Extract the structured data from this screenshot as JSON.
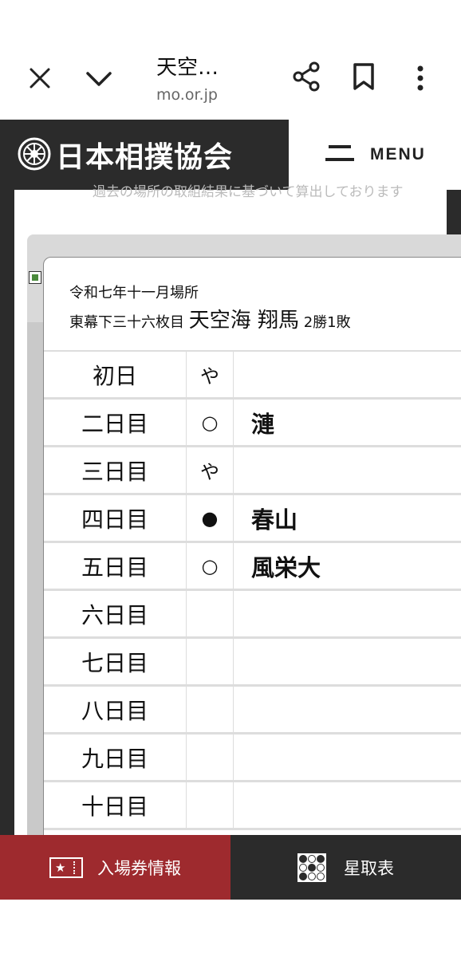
{
  "browser": {
    "page_title": "天空…",
    "url": "mo.or.jp",
    "icons": [
      "close-icon",
      "chevron-down-icon",
      "share-icon",
      "bookmark-icon",
      "more-vert-icon"
    ]
  },
  "site": {
    "logo_text": "日本相撲協会",
    "menu_label": "MENU",
    "behind_text": "過去の場所の取組結果に基づいて算出しております"
  },
  "card": {
    "basho": "令和七年十一月場所",
    "rank": "東幕下三十六枚目",
    "name": "天空海 翔馬",
    "record": "2勝1敗",
    "rows": [
      {
        "day": "初日",
        "result": "や",
        "opponent": ""
      },
      {
        "day": "二日目",
        "result": "○",
        "opponent": "漣"
      },
      {
        "day": "三日目",
        "result": "や",
        "opponent": ""
      },
      {
        "day": "四日目",
        "result": "●",
        "opponent": "春山"
      },
      {
        "day": "五日目",
        "result": "○",
        "opponent": "風栄大"
      },
      {
        "day": "六日目",
        "result": "",
        "opponent": ""
      },
      {
        "day": "七日目",
        "result": "",
        "opponent": ""
      },
      {
        "day": "八日目",
        "result": "",
        "opponent": ""
      },
      {
        "day": "九日目",
        "result": "",
        "opponent": ""
      },
      {
        "day": "十日目",
        "result": "",
        "opponent": ""
      }
    ]
  },
  "bottom_nav": {
    "tickets_label": "入場券情報",
    "standings_label": "星取表",
    "tickets_color": "#9e2a2e",
    "standings_color": "#2b2b2b"
  }
}
